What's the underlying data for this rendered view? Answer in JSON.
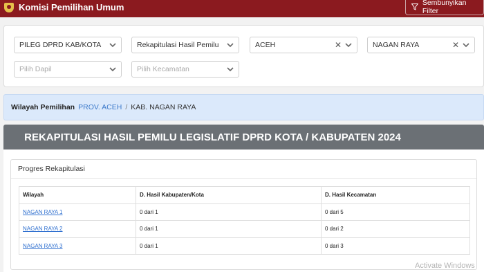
{
  "header": {
    "title": "Komisi Pemilihan Umum",
    "filter_button": "Sembunyikan Filter",
    "accent": "#8b1a1f"
  },
  "filters": {
    "election_type": "PILEG DPRD KAB/KOTA",
    "report_type": "Rekapitulasi Hasil Pemilu",
    "province": "ACEH",
    "regency": "NAGAN RAYA",
    "dapil_placeholder": "Pilih Dapil",
    "kecamatan_placeholder": "Pilih Kecamatan"
  },
  "breadcrumb": {
    "label": "Wilayah Pemilihan",
    "province": "PROV. ACEH",
    "separator": "/",
    "regency": "KAB. NAGAN RAYA"
  },
  "banner": {
    "title": "REKAPITULASI HASIL PEMILU LEGISLATIF DPRD KOTA / KABUPATEN 2024"
  },
  "progress": {
    "title": "Progres Rekapitulasi",
    "columns": [
      "Wilayah",
      "D. Hasil Kabupaten/Kota",
      "D. Hasil Kecamatan"
    ],
    "rows": [
      {
        "wilayah": "NAGAN RAYA 1",
        "kabupaten": "0 dari 1",
        "kecamatan": "0 dari 5"
      },
      {
        "wilayah": "NAGAN RAYA 2",
        "kabupaten": "0 dari 1",
        "kecamatan": "0 dari 2"
      },
      {
        "wilayah": "NAGAN RAYA 3",
        "kabupaten": "0 dari 1",
        "kecamatan": "0 dari 3"
      }
    ]
  },
  "watermark": "Activate Windows"
}
